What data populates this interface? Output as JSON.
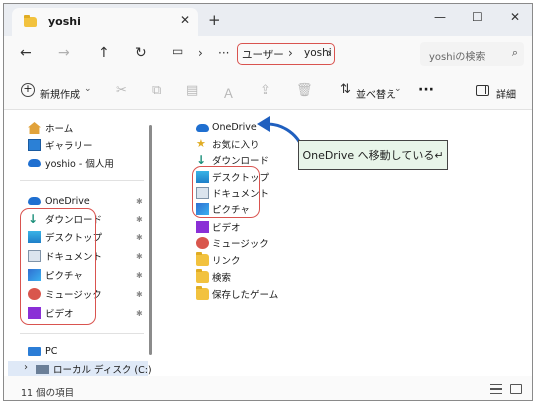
{
  "tab": {
    "title": "yoshi",
    "close": "✕",
    "new_tab": "+"
  },
  "window_controls": {
    "minimize": "—",
    "maximize": "☐",
    "close": "✕"
  },
  "nav": {
    "back": "←",
    "forward": "→",
    "up": "↑",
    "refresh": "↻",
    "sep1": "›",
    "more": "···",
    "sep2": "›",
    "breadcrumb": [
      "ユーザー",
      "yoshi"
    ],
    "bc_sep": "›",
    "search_placeholder": "yoshiの検索",
    "search_icon": "⌕"
  },
  "toolbar": {
    "new_label": "新規作成",
    "new_icon": "+",
    "sort_label": "並べ替え",
    "more": "···",
    "details_label": "詳細",
    "chevron": "⌄"
  },
  "sidebar": {
    "quick": [
      {
        "label": "ホーム",
        "icon": "home-icon"
      },
      {
        "label": "ギャラリー",
        "icon": "gallery-icon"
      },
      {
        "label": "yoshio - 個人用",
        "icon": "cloud-icon"
      }
    ],
    "pinned": [
      {
        "label": "OneDrive",
        "icon": "cloud-icon"
      },
      {
        "label": "ダウンロード",
        "icon": "download-icon"
      },
      {
        "label": "デスクトップ",
        "icon": "desktop-icon"
      },
      {
        "label": "ドキュメント",
        "icon": "document-icon"
      },
      {
        "label": "ピクチャ",
        "icon": "pictures-icon"
      },
      {
        "label": "ミュージック",
        "icon": "music-icon"
      },
      {
        "label": "ビデオ",
        "icon": "video-icon"
      }
    ],
    "pin_glyph": "✱",
    "pc_label": "PC",
    "disk_label": "ローカル ディスク (C:)",
    "disk_chevron": "›"
  },
  "content": {
    "items": [
      {
        "label": "OneDrive",
        "icon": "cloud-icon"
      },
      {
        "label": "お気に入り",
        "icon": "favorites-icon"
      },
      {
        "label": "ダウンロード",
        "icon": "download-icon"
      },
      {
        "label": "デスクトップ",
        "icon": "desktop-icon"
      },
      {
        "label": "ドキュメント",
        "icon": "document-icon"
      },
      {
        "label": "ピクチャ",
        "icon": "pictures-icon"
      },
      {
        "label": "ビデオ",
        "icon": "video-icon"
      },
      {
        "label": "ミュージック",
        "icon": "music-icon"
      },
      {
        "label": "リンク",
        "icon": "link-icon"
      },
      {
        "label": "検索",
        "icon": "folder-icon"
      },
      {
        "label": "保存したゲーム",
        "icon": "folder-icon"
      }
    ]
  },
  "callout": {
    "text": "OneDrive へ移動している↵"
  },
  "status": {
    "count": "11 個の項目"
  },
  "colors": {
    "annotation_red": "#d9534f",
    "callout_fill": "#e8f5e9",
    "accent_blue": "#1f6fd0"
  }
}
